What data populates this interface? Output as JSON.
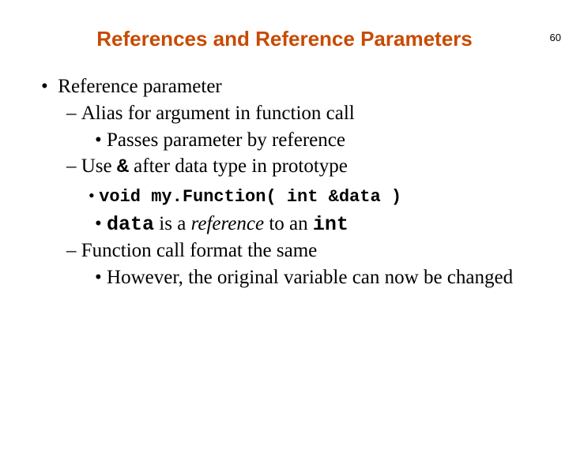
{
  "page_number": "60",
  "title": "References and Reference Parameters",
  "bullets": {
    "l1": "Reference parameter",
    "l2a": "Alias for argument in function call",
    "l3a": "Passes parameter by reference",
    "l2b_pre": "Use ",
    "l2b_amp": "&",
    "l2b_post": " after data type in prototype",
    "code": "void my.Function( int &data )",
    "l3c_code1": "data",
    "l3c_mid": " is a ",
    "l3c_ital": "reference",
    "l3c_mid2": " to an ",
    "l3c_code2": "int",
    "l2c": "Function call format the same",
    "l3d": "However, the original variable can now be changed"
  }
}
